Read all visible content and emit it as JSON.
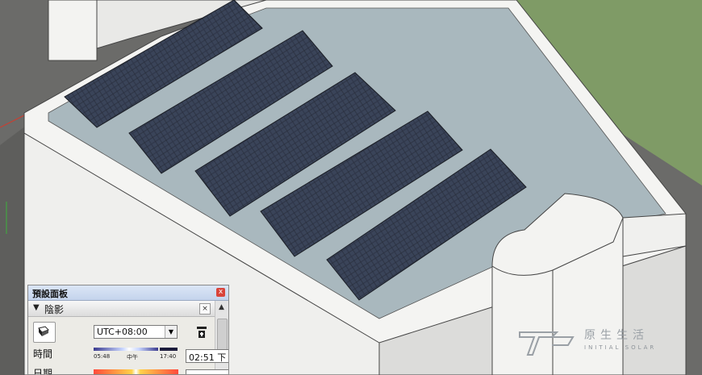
{
  "tray": {
    "title": "預設面板",
    "close_glyph": "x"
  },
  "shadows": {
    "section_label": "陰影",
    "toggle_glyph": "▼",
    "close_glyph": "×",
    "toggle_icon": "shadow-toggle-icon",
    "timezone": "UTC+08:00",
    "time_label": "時間",
    "time_ticks": {
      "start": "05:48",
      "noon": "中午",
      "end": "17:40"
    },
    "time_value": "02:51 下",
    "time_slider_position": 0.56,
    "date_label": "日期"
  },
  "watermark": {
    "brand_cn": "原生生活",
    "brand_en": "INITIAL SOLAR"
  },
  "colors": {
    "roof": "#a9b7bd",
    "wall": "#f1f1ef",
    "panel": "#2e3340",
    "ground": "#6d6d6b"
  }
}
